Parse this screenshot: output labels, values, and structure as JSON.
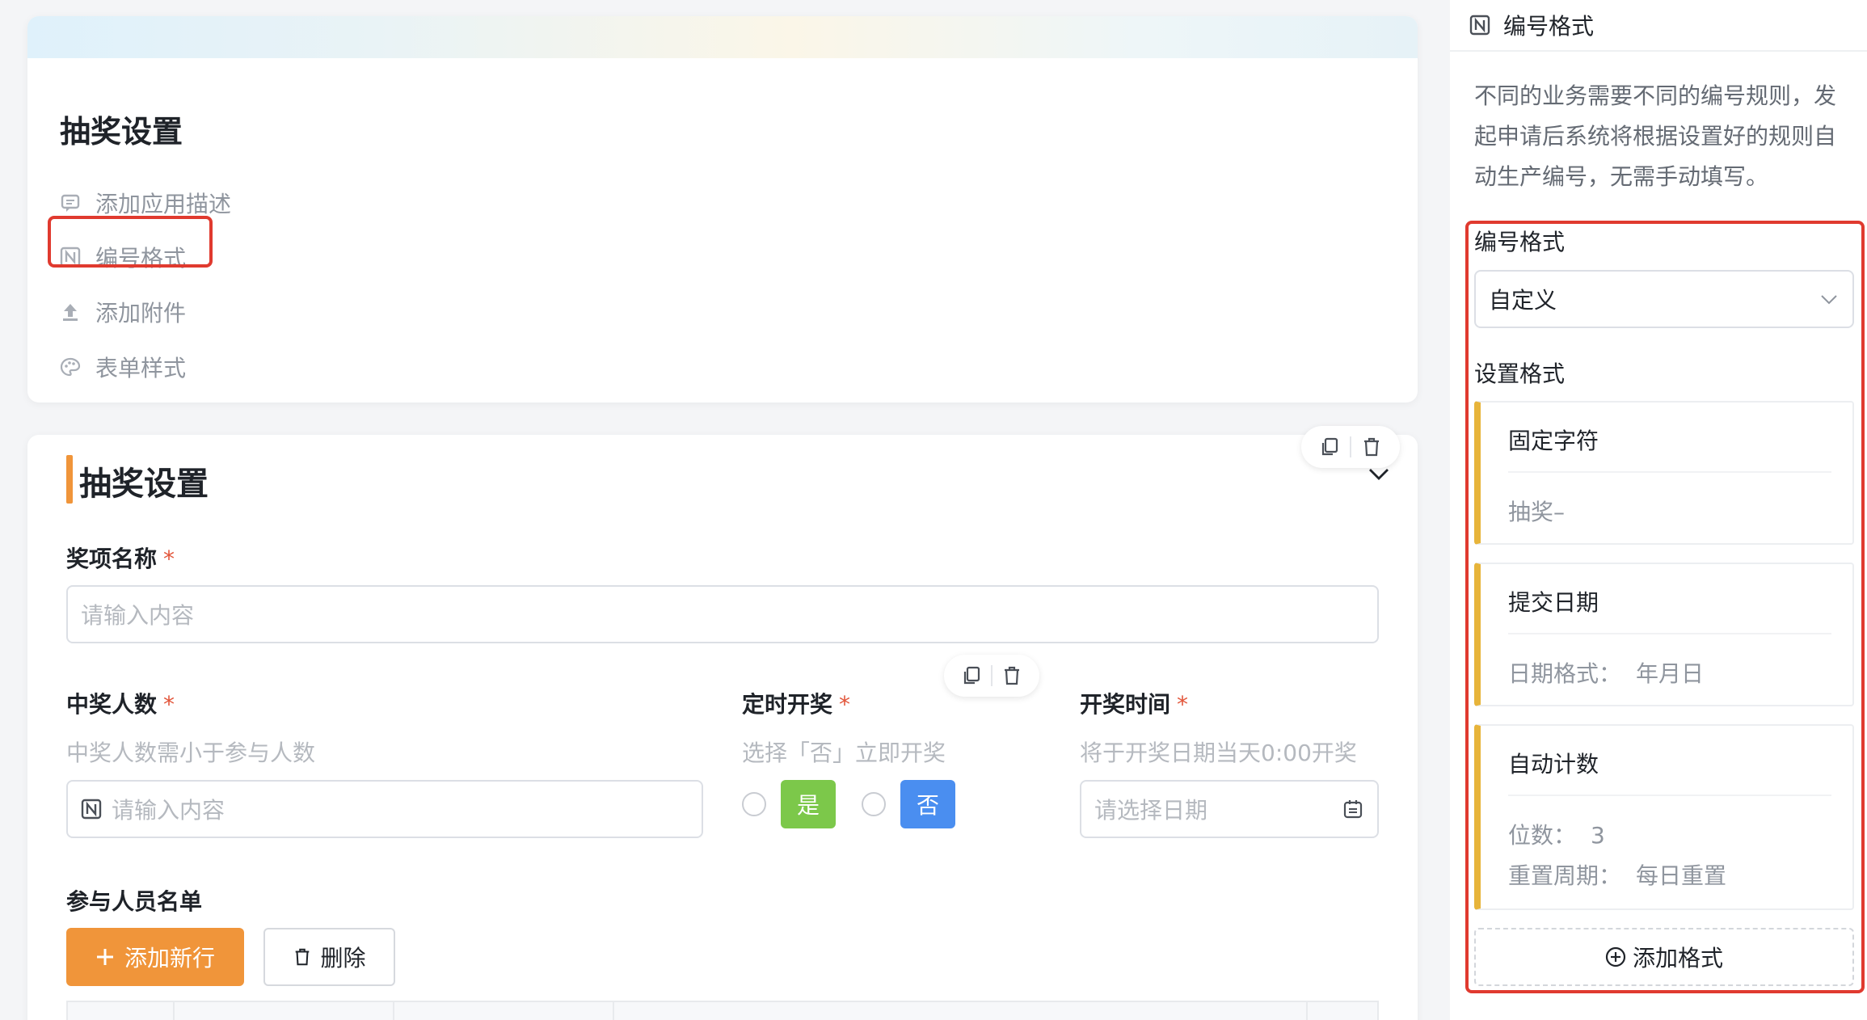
{
  "settings_card": {
    "title": "抽奖设置",
    "menu": [
      {
        "label": "添加应用描述",
        "icon": "comment-icon"
      },
      {
        "label": "编号格式",
        "icon": "number-format-icon"
      },
      {
        "label": "添加附件",
        "icon": "upload-icon"
      },
      {
        "label": "表单样式",
        "icon": "palette-icon"
      }
    ]
  },
  "form": {
    "section_title": "抽奖设置",
    "prize_name": {
      "label": "奖项名称",
      "required": "*",
      "placeholder": "请输入内容"
    },
    "winners": {
      "label": "中奖人数",
      "required": "*",
      "hint": "中奖人数需小于参与人数",
      "placeholder": "请输入内容"
    },
    "scheduled": {
      "label": "定时开奖",
      "required": "*",
      "hint": "选择「否」立即开奖",
      "yes": "是",
      "no": "否"
    },
    "draw_time": {
      "label": "开奖时间",
      "required": "*",
      "hint": "将于开奖日期当天0:00开奖",
      "placeholder": "请选择日期"
    },
    "participants": {
      "label": "参与人员名单",
      "add_row": "添加新行",
      "delete": "删除"
    }
  },
  "panel": {
    "title": "编号格式",
    "description": "不同的业务需要不同的编号规则，发起申请后系统将根据设置好的规则自动生产编号，无需手动填写。",
    "format_label": "编号格式",
    "format_value": "自定义",
    "set_format_label": "设置格式",
    "items": [
      {
        "title": "固定字符",
        "value": "抽奖–"
      },
      {
        "title": "提交日期",
        "key": "日期格式：",
        "value": "年月日"
      },
      {
        "title": "自动计数",
        "digits_key": "位数：",
        "digits_value": "3",
        "reset_key": "重置周期：",
        "reset_value": "每日重置"
      }
    ],
    "add_format": "添加格式"
  },
  "colors": {
    "accent_orange": "#f0953a",
    "yes_green": "#7cc84a",
    "no_blue": "#4a8ef0",
    "highlight_red": "#e03a2f",
    "card_stripe": "#e7b43a"
  }
}
